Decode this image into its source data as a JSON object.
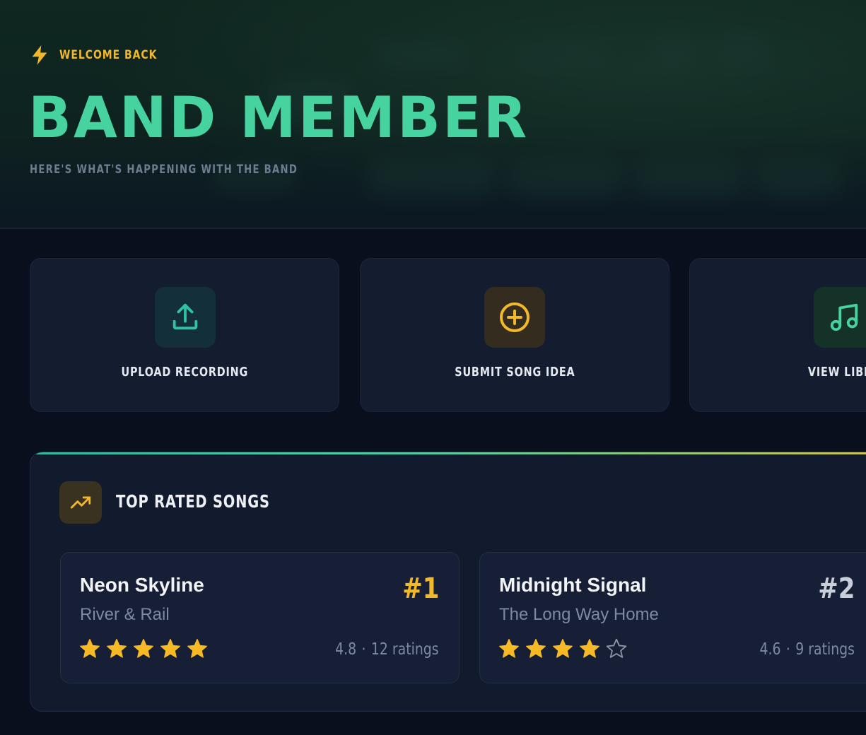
{
  "header": {
    "welcome": "WELCOME BACK",
    "title": "BAND MEMBER",
    "subtitle": "HERE'S WHAT'S HAPPENING WITH THE BAND"
  },
  "actions": [
    {
      "label": "UPLOAD RECORDING",
      "icon": "upload-icon",
      "color": "#2fc2a6"
    },
    {
      "label": "SUBMIT SONG IDEA",
      "icon": "plus-circle-icon",
      "color": "#f2b82a"
    },
    {
      "label": "VIEW LIBRA",
      "icon": "music-note-icon",
      "color": "#46d39f"
    }
  ],
  "top_rated": {
    "title": "TOP RATED SONGS",
    "icon": "trending-up-icon",
    "songs": [
      {
        "title": "Neon Skyline",
        "artist": "River & Rail",
        "rank": "#1",
        "rank_color": "#f2b82a",
        "rating": "4.8",
        "ratings_count": "12 ratings",
        "stars": 5
      },
      {
        "title": "Midnight Signal",
        "artist": "The Long Way Home",
        "rank": "#2",
        "rank_color": "#c9cfd9",
        "rating": "4.6",
        "ratings_count": "9 ratings",
        "stars": 4
      }
    ]
  },
  "colors": {
    "accent_gold": "#f2b82a",
    "accent_green": "#46d39f",
    "star_filled": "#f7b924",
    "star_empty": "#8b93a6"
  }
}
